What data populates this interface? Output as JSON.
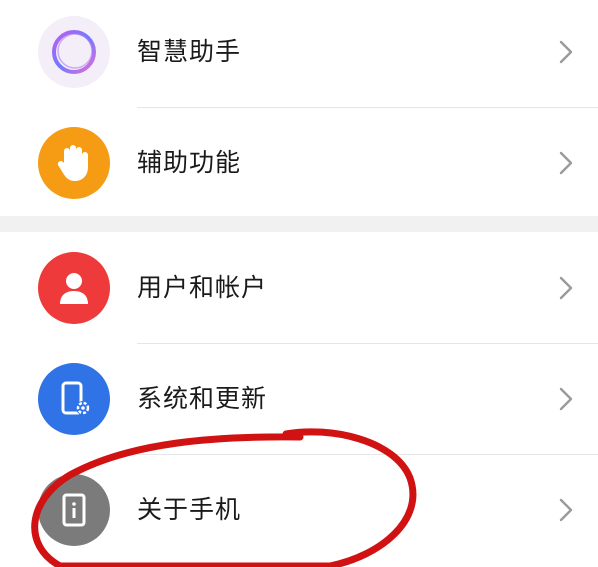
{
  "settings": {
    "group1": [
      {
        "label": "智慧助手",
        "icon": "smart-assistant-icon",
        "color": "#f3eef8"
      },
      {
        "label": "辅助功能",
        "icon": "hand-icon",
        "color": "#f59b14"
      }
    ],
    "group2": [
      {
        "label": "用户和帐户",
        "icon": "user-icon",
        "color": "#ee3a3a"
      },
      {
        "label": "系统和更新",
        "icon": "phone-settings-icon",
        "color": "#2f73e6"
      },
      {
        "label": "关于手机",
        "icon": "phone-info-icon",
        "color": "#7b7b7b"
      }
    ]
  },
  "annotation": {
    "color": "#d11212",
    "type": "red-circle-highlight"
  }
}
